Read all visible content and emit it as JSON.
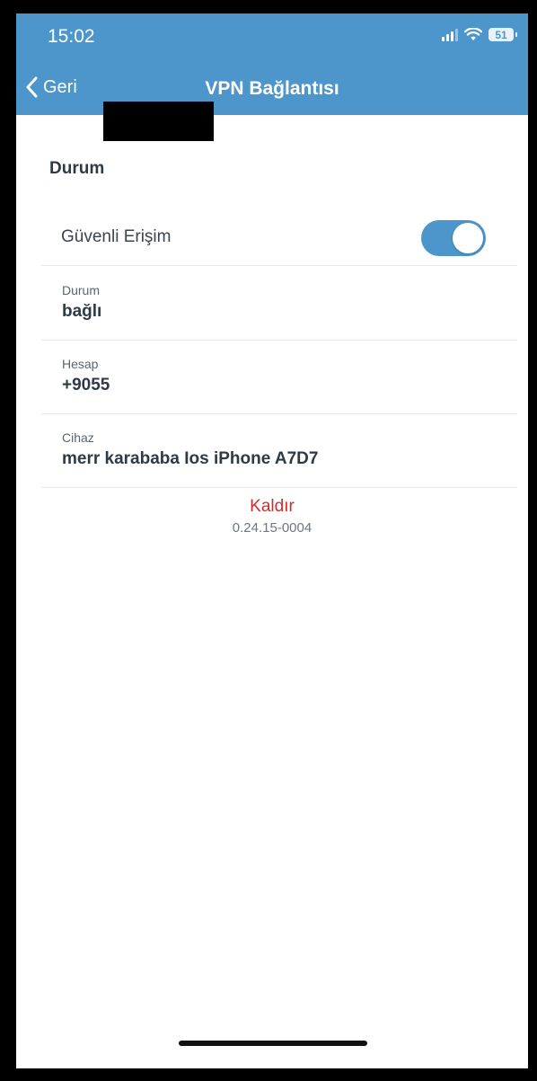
{
  "status_bar": {
    "time": "15:02",
    "battery": "51",
    "signal_icon": "cellular-signal-icon",
    "wifi_icon": "wifi-icon"
  },
  "nav": {
    "back_label": "Geri",
    "title": "VPN Bağlantısı",
    "bar_color": "#4d96cc"
  },
  "section": {
    "title": "Durum"
  },
  "toggle_row": {
    "label": "Güvenli Erişim",
    "enabled": true
  },
  "info_rows": [
    {
      "label": "Durum",
      "value": "bağlı"
    },
    {
      "label": "Hesap",
      "value": "+9055"
    },
    {
      "label": "Cihaz",
      "value": "merr karababa Ios iPhone A7D7"
    }
  ],
  "remove_label": "Kaldır",
  "version": "0.24.15-0004",
  "colors": {
    "accent": "#4d96cc",
    "danger": "#d32b2b"
  }
}
